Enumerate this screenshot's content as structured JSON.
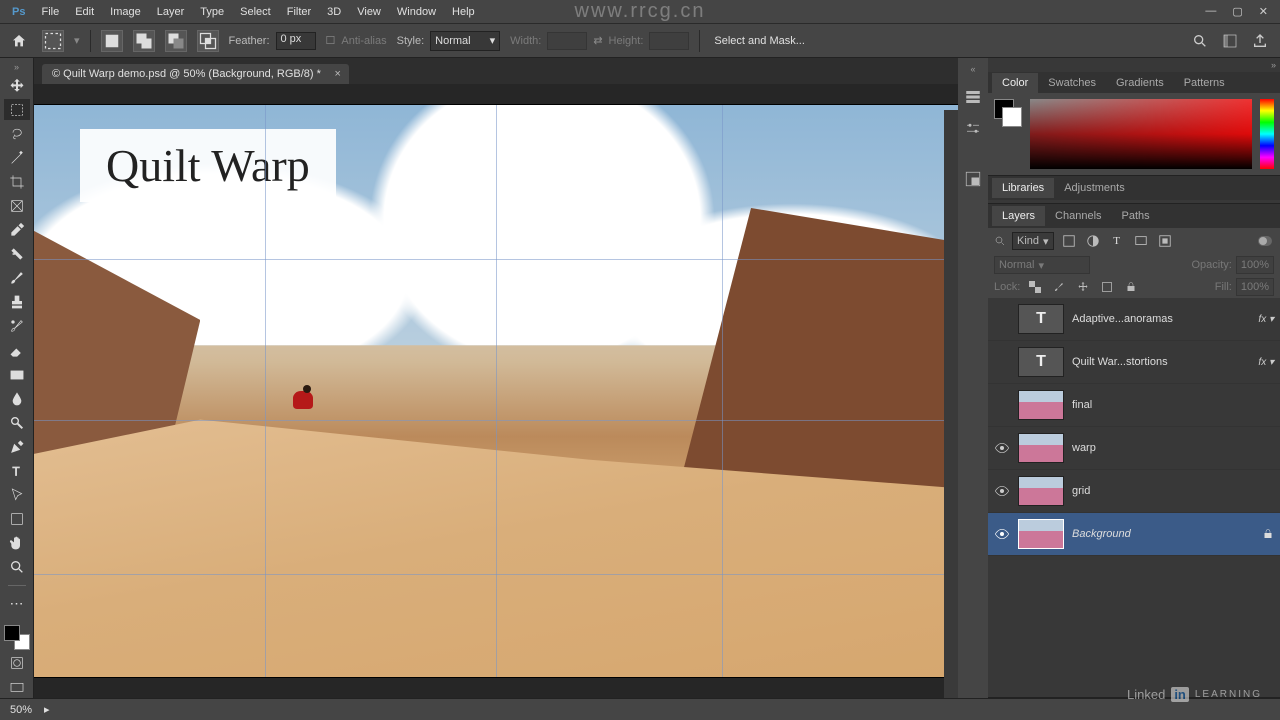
{
  "app_logo": "Ps",
  "menubar": [
    "File",
    "Edit",
    "Image",
    "Layer",
    "Type",
    "Select",
    "Filter",
    "3D",
    "View",
    "Window",
    "Help"
  ],
  "optionsbar": {
    "feather_label": "Feather:",
    "feather_value": "0 px",
    "antialias": "Anti-alias",
    "style_label": "Style:",
    "style_value": "Normal",
    "width_label": "Width:",
    "height_label": "Height:",
    "select_mask": "Select and Mask..."
  },
  "document": {
    "tab_title": "© Quilt Warp demo.psd @ 50% (Background, RGB/8) *",
    "overlay_text": "Quilt Warp",
    "watermark": "www.rrcg.cn"
  },
  "right_panels": {
    "color_tabs": [
      "Color",
      "Swatches",
      "Gradients",
      "Patterns"
    ],
    "lib_tabs": [
      "Libraries",
      "Adjustments"
    ],
    "layer_tabs": [
      "Layers",
      "Channels",
      "Paths"
    ],
    "layers_filter": "Kind",
    "blend_mode": "Normal",
    "opacity_label": "Opacity:",
    "opacity_value": "100%",
    "lock_label": "Lock:",
    "fill_label": "Fill:",
    "fill_value": "100%",
    "layers": [
      {
        "name": "Adaptive...anoramas",
        "type": "T",
        "fx": true
      },
      {
        "name": "Quilt War...stortions",
        "type": "T",
        "fx": true
      },
      {
        "name": "final",
        "type": "img",
        "visible": false
      },
      {
        "name": "warp",
        "type": "img",
        "visible": true
      },
      {
        "name": "grid",
        "type": "img",
        "visible": true
      },
      {
        "name": "Background",
        "type": "img",
        "visible": true,
        "locked": true,
        "selected": true
      }
    ]
  },
  "statusbar": {
    "zoom": "50%"
  },
  "branding": {
    "linkedin": "Linked",
    "in": "in",
    "learning": "LEARNING"
  }
}
